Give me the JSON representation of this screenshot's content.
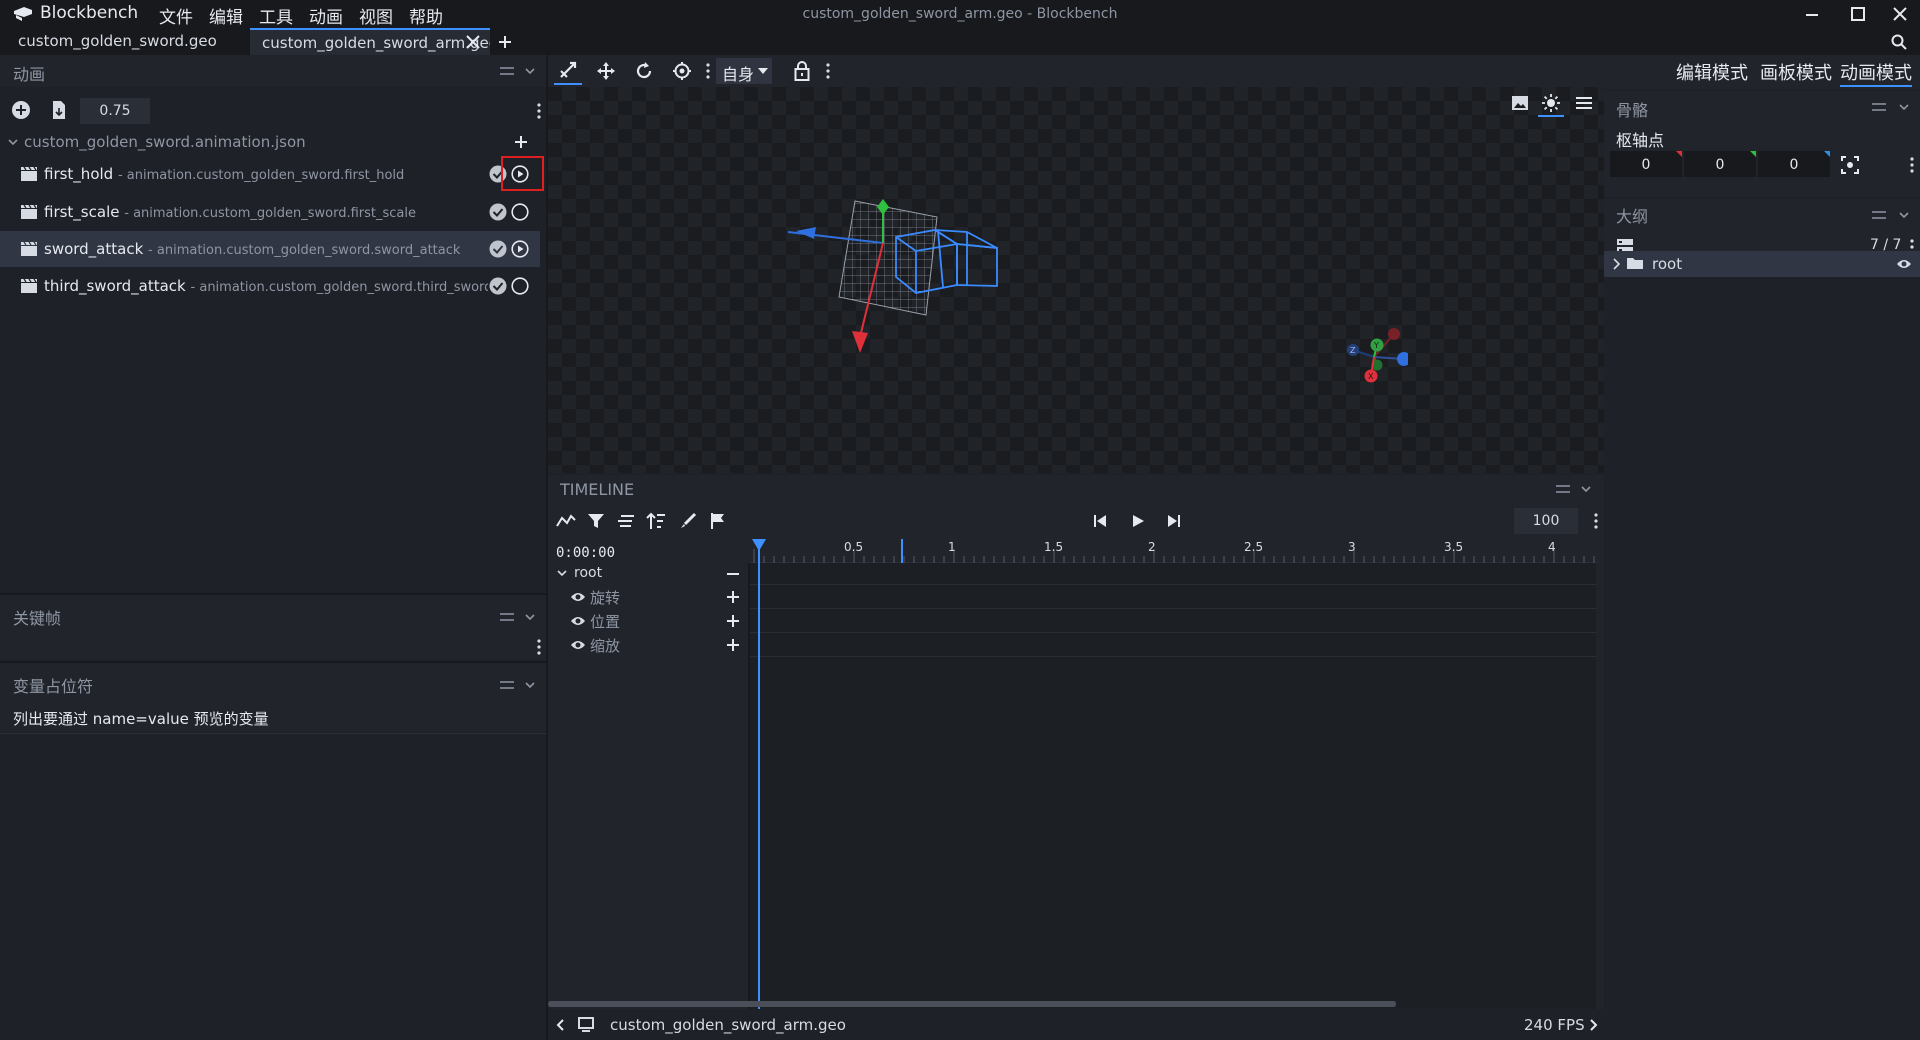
{
  "app": {
    "name": "Blockbench",
    "window_title": "custom_golden_sword_arm.geo - Blockbench",
    "menu": [
      "文件",
      "编辑",
      "工具",
      "动画",
      "视图",
      "帮助"
    ]
  },
  "tabs": [
    {
      "label": "custom_golden_sword.geo",
      "active": false
    },
    {
      "label": "custom_golden_sword_arm.geo",
      "active": true
    }
  ],
  "animation_panel": {
    "title": "动画",
    "speed_value": "0.75",
    "file_name": "custom_golden_sword.animation.json",
    "animations": [
      {
        "name": "first_hold",
        "path": "- animation.custom_golden_sword.first_hold",
        "playing": true,
        "selected": false
      },
      {
        "name": "first_scale",
        "path": "- animation.custom_golden_sword.first_scale",
        "playing": false,
        "selected": false
      },
      {
        "name": "sword_attack",
        "path": "- animation.custom_golden_sword.sword_attack",
        "playing": true,
        "selected": true
      },
      {
        "name": "third_sword_attack",
        "path": "- animation.custom_golden_sword.third_sword_attack",
        "playing": false,
        "selected": false
      }
    ]
  },
  "keyframe_panel": {
    "title": "关键帧"
  },
  "variable_panel": {
    "title": "变量占位符",
    "hint": "列出要通过 name=value 预览的变量"
  },
  "toolbar": {
    "space_select": "自身"
  },
  "timeline": {
    "title": "TIMELINE",
    "time": "0:00:00",
    "fps_input": "100",
    "ruler_labels": [
      "0.5",
      "1",
      "1.5",
      "2",
      "2.5",
      "3",
      "3.5",
      "4"
    ],
    "group": "root",
    "channels": [
      "旋转",
      "位置",
      "缩放"
    ],
    "footer_file": "custom_golden_sword_arm.geo",
    "footer_fps": "240 FPS"
  },
  "right_panel": {
    "modes": [
      "编辑模式",
      "画板模式",
      "动画模式"
    ],
    "active_mode": "动画模式",
    "bone_title": "骨骼",
    "pivot_label": "枢轴点",
    "pivot": [
      "0",
      "0",
      "0"
    ],
    "outliner_title": "大纲",
    "outliner_count": "7 / 7",
    "outliner_root": "root"
  },
  "colors": {
    "accent": "#3e90ff",
    "highlight_box": "#e02020",
    "axis_x": "#e0303a",
    "axis_y": "#30c040",
    "axis_z": "#2f6fe0"
  }
}
